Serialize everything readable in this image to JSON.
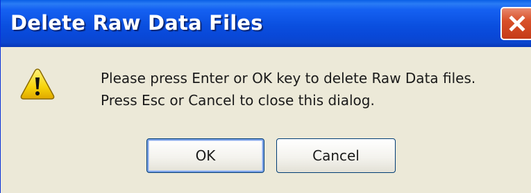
{
  "dialog": {
    "title": "Delete Raw Data Files",
    "icons": {
      "close": "close-icon",
      "warning": "warning-icon"
    },
    "message_lines": [
      "Please press Enter or OK key to delete Raw Data files.",
      "Press Esc or Cancel to close this dialog."
    ],
    "buttons": {
      "ok_label": "OK",
      "cancel_label": "Cancel"
    },
    "colors": {
      "titlebar": "#0a4fdf",
      "close_button": "#d9512a",
      "face": "#ece9d8",
      "warning_fill": "#f7d40a"
    }
  }
}
